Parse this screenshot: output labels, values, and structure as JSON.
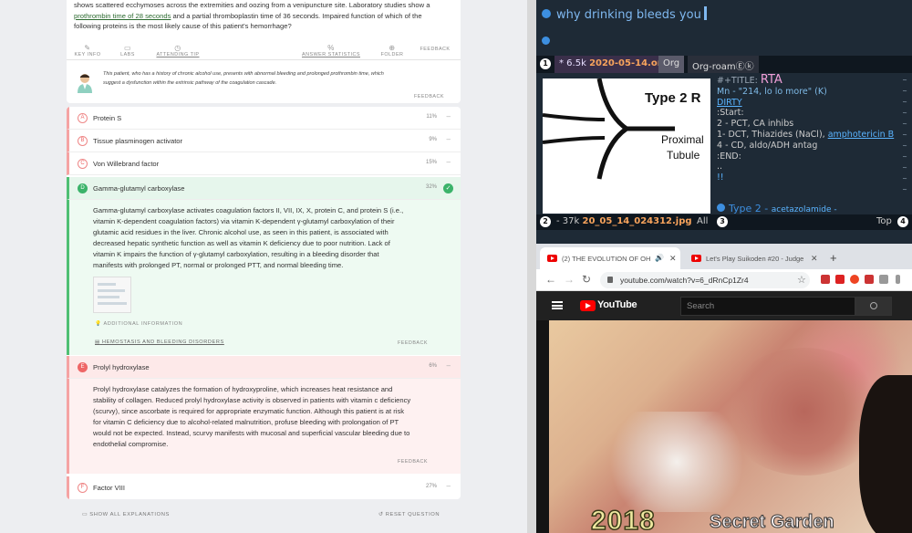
{
  "question": {
    "stem_line1": "shows scattered ecchymoses across the extremities and oozing from a venipuncture site. Laboratory studies show a",
    "stem_link": "prothrombin time of 28 seconds",
    "stem_line2": "and a partial thromboplastin time of 36 seconds. Impaired function of which of the",
    "stem_line3": "following proteins is the most likely cause of this patient's hemorrhage?"
  },
  "tools": {
    "key_info": "KEY INFO",
    "labs": "LABS",
    "attending_tip": "ATTENDING TIP",
    "answer_statistics": "ANSWER STATISTICS",
    "folder": "FOLDER",
    "feedback": "FEEDBACK"
  },
  "hint": {
    "line1": "This patient, who has a history of chronic alcohol use, presents with abnormal bleeding and prolonged prothrombin time, which",
    "line2": "suggest a dysfunction within the extrinsic pathway of the coagulation cascade.",
    "feedback": "FEEDBACK"
  },
  "options": [
    {
      "letter": "A",
      "text": "Protein S",
      "pct": "11%"
    },
    {
      "letter": "B",
      "text": "Tissue plasminogen activator",
      "pct": "9%"
    },
    {
      "letter": "C",
      "text": "Von Willebrand factor",
      "pct": "15%"
    },
    {
      "letter": "D",
      "text": "Gamma-glutamyl carboxylase",
      "pct": "32%"
    },
    {
      "letter": "E",
      "text": "Prolyl hydroxylase",
      "pct": "6%"
    },
    {
      "letter": "F",
      "text": "Factor VIII",
      "pct": "27%"
    }
  ],
  "explanation_d": {
    "l1": "Gamma-glutamyl carboxylase activates coagulation factors II, VII, IX, X, protein C, and protein S (i.e.,",
    "l2": "vitamin K-dependent coagulation factors) via vitamin K-dependent γ-glutamyl carboxylation of their",
    "l3": "glutamic acid residues in the liver. Chronic alcohol use, as seen in this patient, is associated with",
    "l4": "decreased hepatic synthetic function as well as vitamin K deficiency due to poor nutrition. Lack of",
    "l5": "vitamin K impairs the function of γ-glutamyl carboxylation, resulting in a bleeding disorder that",
    "l6": "manifests with prolonged PT, normal or prolonged PTT, and normal bleeding time.",
    "additional": "ADDITIONAL INFORMATION",
    "link": "HEMOSTASIS AND BLEEDING DISORDERS",
    "feedback": "FEEDBACK"
  },
  "explanation_e": {
    "l1": "Prolyl hydroxylase catalyzes the formation of hydroxyproline, which increases heat resistance and",
    "l2": "stability of collagen. Reduced prolyl hydroxylase activity is observed in patients with vitamin c deficiency",
    "l3": "(scurvy), since ascorbate is required for appropriate enzymatic function. Although this patient is at risk",
    "l4": "for vitamin C deficiency due to alcohol-related malnutrition, profuse bleeding with prolongation of PT",
    "l5": "would not be expected. Instead, scurvy manifests with mucosal and superficial vascular bleeding due to",
    "l6": "endothelial compromise.",
    "feedback": "FEEDBACK"
  },
  "footer": {
    "show_all": "SHOW ALL EXPLANATIONS",
    "reset": "RESET QUESTION"
  },
  "emacs": {
    "search": "why drinking bleeds you",
    "tab_num": "1",
    "tab1_prefix": "* 6.5k",
    "tab1_file": "2020-05-14.org",
    "tab2": "Org",
    "tab3": "Org-roam",
    "tab3_suffix": "Ⓔⓚ",
    "image_label1": "Type 2 R",
    "image_label2": "Proximal",
    "image_label3": "Tubule",
    "title_key": "#+TITLE:",
    "title": "RTA",
    "mn": "Mn - \"214, lo lo more\" (K)",
    "dirty": "DIRTY",
    "start": ":Start:",
    "l2": "2 - PCT, CA inhibs",
    "l1": "1- DCT, Thiazides (NaCl),",
    "amph": "amphotericin B",
    "l4": "4 - CD, aldo/ADH antag",
    "end": ":END:",
    "dots": "..",
    "bang": "!!",
    "type2": "Type 2 -",
    "type2_sub": "acetazolamide -",
    "ml_num": "2",
    "ml_prefix": "- 37k",
    "ml_file": "20_05_14_024312.jpg",
    "ml_all": "All",
    "ml_num2": "3",
    "ml_top": "Top",
    "ml_num3": "4"
  },
  "browser": {
    "tab1": "(2) THE EVOLUTION OF OH",
    "tab2": "Let's Play Suikoden #20 - Judge",
    "url": "youtube.com/watch?v=6_dRnCp1Zr4",
    "yt_name": "YouTube",
    "search_placeholder": "Search",
    "caption1": "2018",
    "caption2": "Secret Garden"
  }
}
